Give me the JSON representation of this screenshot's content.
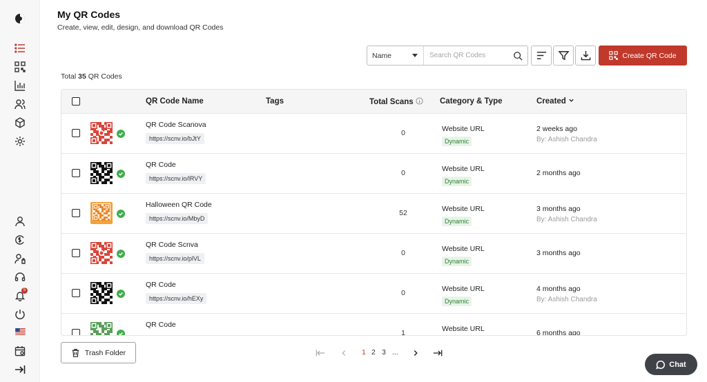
{
  "page": {
    "title": "My QR Codes",
    "subtitle": "Create, view, edit, design, and download QR Codes"
  },
  "sidebar": {
    "top_icons": [
      "logo-icon",
      "list-icon",
      "qr-icon",
      "analytics-icon",
      "users-icon",
      "package-icon",
      "gear-icon"
    ],
    "bottom_icons": [
      "account-icon",
      "billing-icon",
      "team-icon",
      "support-icon",
      "bell-icon",
      "power-icon",
      "us-flag-icon",
      "calendar-icon",
      "collapse-icon"
    ],
    "notification_count": "5",
    "active_color": "#c0392b"
  },
  "toolbar": {
    "filter_field": "Name",
    "search_placeholder": "Search QR Codes",
    "create_label": "Create QR Code",
    "accent": "#c0392b"
  },
  "summary": {
    "prefix": "Total",
    "count": "35",
    "suffix": "QR Codes"
  },
  "table": {
    "headers": {
      "name": "QR Code Name",
      "tags": "Tags",
      "scans": "Total Scans",
      "category": "Category & Type",
      "created": "Created"
    },
    "rows": [
      {
        "name": "QR Code Scanova",
        "url": "https://scnv.io/bJtY",
        "scans": "0",
        "category": "Website URL",
        "type": "Dynamic",
        "created": "2 weeks ago",
        "by": "By: Ashish Chandra",
        "qr_style": "red"
      },
      {
        "name": "QR Code",
        "url": "https://scnv.io/lRVY",
        "scans": "0",
        "category": "Website URL",
        "type": "Dynamic",
        "created": "2 months ago",
        "by": "",
        "qr_style": "black"
      },
      {
        "name": "Halloween QR Code",
        "url": "https://scnv.io/MbyD",
        "scans": "52",
        "category": "Website URL",
        "type": "Dynamic",
        "created": "3 months ago",
        "by": "By: Ashish Chandra",
        "qr_style": "orange"
      },
      {
        "name": "QR Code Scnva",
        "url": "https://scnv.io/plVL",
        "scans": "0",
        "category": "Website URL",
        "type": "Dynamic",
        "created": "3 months ago",
        "by": "",
        "qr_style": "red"
      },
      {
        "name": "QR Code",
        "url": "https://scnv.io/hEXy",
        "scans": "0",
        "category": "Website URL",
        "type": "Dynamic",
        "created": "4 months ago",
        "by": "By: Ashish Chandra",
        "qr_style": "black"
      },
      {
        "name": "QR Code",
        "url": "",
        "scans": "1",
        "category": "Website URL",
        "type": "",
        "created": "6 months ago",
        "by": "",
        "qr_style": "green"
      }
    ]
  },
  "footer": {
    "trash_label": "Trash Folder",
    "pages": [
      "1",
      "2",
      "3",
      "..."
    ],
    "current_page": "1",
    "chat_label": "Chat"
  }
}
